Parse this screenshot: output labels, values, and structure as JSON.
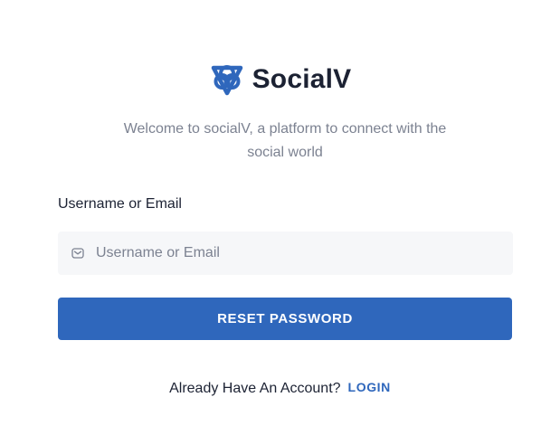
{
  "brand": {
    "name": "SocialV",
    "logo_icon": "socialv-logo-icon"
  },
  "tagline": "Welcome to socialV, a platform to connect with the social world",
  "form": {
    "field_label": "Username or Email",
    "input_placeholder": "Username or Email",
    "input_value": "",
    "input_icon": "mail-icon",
    "submit_label": "RESET PASSWORD"
  },
  "footer": {
    "prompt": "Already Have An Account?",
    "login_label": "LOGIN"
  },
  "colors": {
    "accent": "#2f67bc",
    "text": "#1c2233",
    "muted": "#7c8291",
    "input_bg": "#f6f7f9"
  }
}
